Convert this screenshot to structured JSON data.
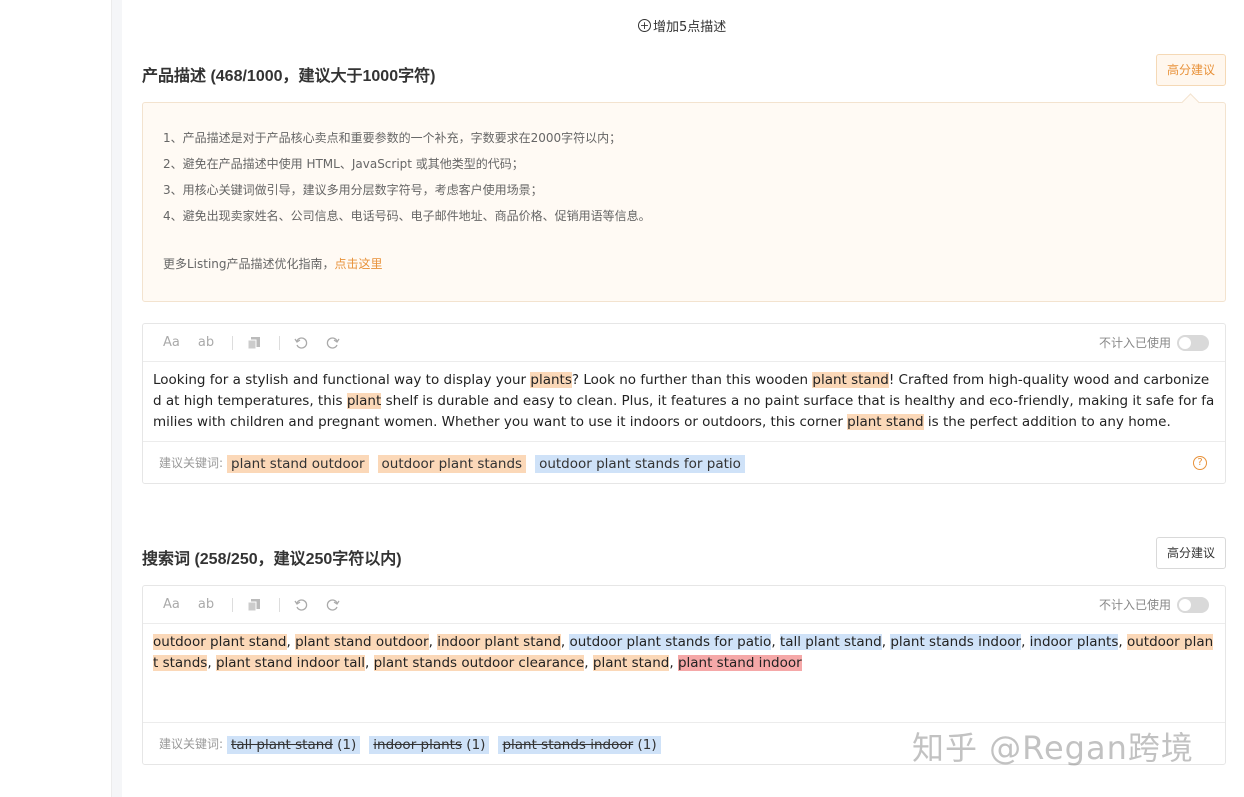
{
  "add_points": {
    "label": "增加5点描述"
  },
  "description": {
    "title": "产品描述 (468/1000，建议大于1000字符)",
    "advice_label": "高分建议",
    "tips": [
      "1、产品描述是对于产品核心卖点和重要参数的一个补充，字数要求在2000字符以内；",
      "2、避免在产品描述中使用 HTML、JavaScript 或其他类型的代码；",
      "3、用核心关键词做引导，建议多用分层数字符号，考虑客户使用场景；",
      "4、避免出现卖家姓名、公司信息、电话号码、电子邮件地址、商品价格、促销用语等信息。"
    ],
    "guide_text": "更多Listing产品描述优化指南，",
    "guide_link": "点击这里",
    "toolbar": {
      "case_label": "Aa",
      "lower_label": "ab",
      "toggle_label": "不计入已使用"
    },
    "text": [
      {
        "t": "Looking for a stylish and functional way to display your ",
        "h": ""
      },
      {
        "t": "plants",
        "h": "o"
      },
      {
        "t": "? Look no further than this wooden ",
        "h": ""
      },
      {
        "t": "plant stand",
        "h": "o"
      },
      {
        "t": "! Crafted from high-quality wood and carbonized at high temperatures, this ",
        "h": ""
      },
      {
        "t": "plant",
        "h": "o"
      },
      {
        "t": " shelf is durable and easy to clean. Plus, it features a no paint surface that is healthy and eco-friendly, making it safe for families with children and pregnant women. Whether you want to use it indoors or outdoors, this corner ",
        "h": ""
      },
      {
        "t": "plant stand",
        "h": "o"
      },
      {
        "t": " is the perfect addition to any home.",
        "h": ""
      }
    ],
    "kw_label": "建议关键词:",
    "keywords": [
      {
        "text": "plant stand outdoor",
        "color": "o"
      },
      {
        "text": "outdoor plant stands",
        "color": "o"
      },
      {
        "text": "outdoor plant stands for patio",
        "color": "b"
      }
    ]
  },
  "search_terms": {
    "title": "搜索词 (258/250，建议250字符以内)",
    "advice_label": "高分建议",
    "toolbar": {
      "case_label": "Aa",
      "lower_label": "ab",
      "toggle_label": "不计入已使用"
    },
    "text": [
      {
        "t": "outdoor plant stand",
        "h": "o"
      },
      {
        "t": ", ",
        "h": ""
      },
      {
        "t": "plant stand outdoor",
        "h": "o"
      },
      {
        "t": ", ",
        "h": ""
      },
      {
        "t": "indoor plant stand",
        "h": "o"
      },
      {
        "t": ", ",
        "h": ""
      },
      {
        "t": "outdoor plant stands for patio",
        "h": "b"
      },
      {
        "t": ", ",
        "h": ""
      },
      {
        "t": "tall plant stand",
        "h": "b"
      },
      {
        "t": ", ",
        "h": ""
      },
      {
        "t": "plant stands indoor",
        "h": "b"
      },
      {
        "t": ", ",
        "h": ""
      },
      {
        "t": "indoor plants",
        "h": "b"
      },
      {
        "t": ", ",
        "h": ""
      },
      {
        "t": "outdoor plant stands",
        "h": "o"
      },
      {
        "t": ", ",
        "h": ""
      },
      {
        "t": "plant stand indoor tall",
        "h": "o"
      },
      {
        "t": ", ",
        "h": ""
      },
      {
        "t": "plant stands outdoor clearance",
        "h": "o"
      },
      {
        "t": ", ",
        "h": ""
      },
      {
        "t": "plant stand",
        "h": "o"
      },
      {
        "t": ", ",
        "h": ""
      },
      {
        "t": "plant stand indoor",
        "h": "r"
      }
    ],
    "kw_label": "建议关键词:",
    "keywords": [
      {
        "text": "tall plant stand",
        "count": "(1)",
        "color": "b"
      },
      {
        "text": "indoor plants",
        "count": "(1)",
        "color": "b"
      },
      {
        "text": "plant stands indoor",
        "count": "(1)",
        "color": "b"
      }
    ]
  },
  "watermark": "知乎 @Regan跨境",
  "colors": {
    "accent": "#e8923a",
    "highlight_orange": "#fbd8b8",
    "highlight_blue": "#cfe2f8",
    "highlight_red": "#f5a8a8"
  }
}
